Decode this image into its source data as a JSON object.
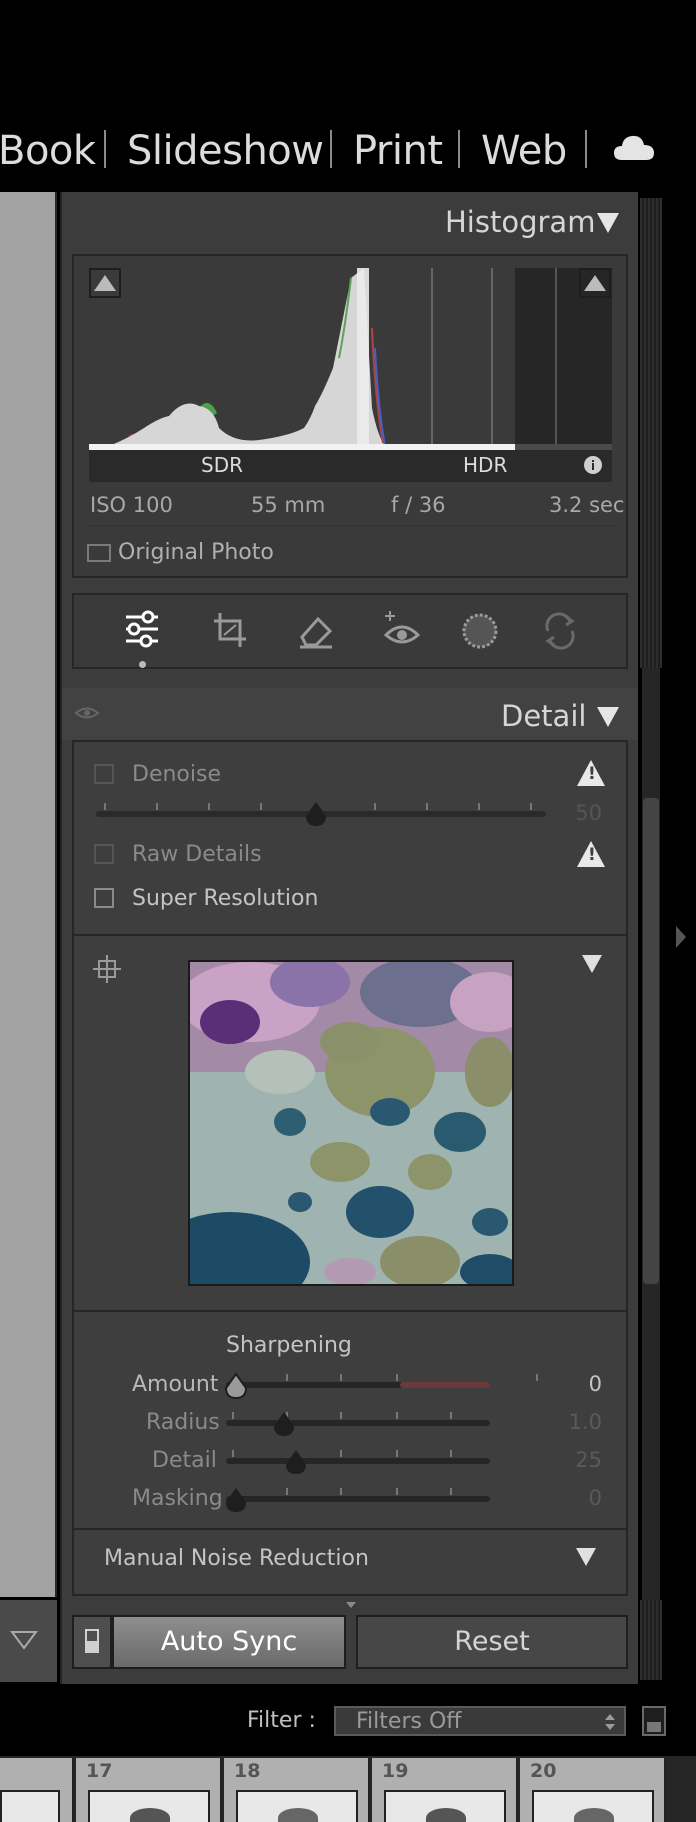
{
  "modules": [
    "Book",
    "Slideshow",
    "Print",
    "Web"
  ],
  "histogram": {
    "title": "Histogram",
    "sdr_label": "SDR",
    "hdr_label": "HDR",
    "iso": "ISO 100",
    "focal_length": "55 mm",
    "aperture": "f / 36",
    "shutter": "3.2 sec",
    "original_photo_label": "Original Photo"
  },
  "detail": {
    "title": "Detail",
    "denoise_label": "Denoise",
    "denoise_value": "50",
    "raw_details_label": "Raw Details",
    "super_resolution_label": "Super Resolution",
    "sharpening_title": "Sharpening",
    "sliders": [
      {
        "label": "Amount",
        "value": "0"
      },
      {
        "label": "Radius",
        "value": "1.0"
      },
      {
        "label": "Detail",
        "value": "25"
      },
      {
        "label": "Masking",
        "value": "0"
      }
    ],
    "noise_reduction_label": "Manual Noise Reduction"
  },
  "buttons": {
    "auto_sync": "Auto Sync",
    "reset": "Reset"
  },
  "filter": {
    "label": "Filter :",
    "value": "Filters Off"
  },
  "filmstrip": {
    "numbers": [
      "17",
      "18",
      "19",
      "20"
    ]
  },
  "colors": {
    "panel_bg": "#3c3c3c",
    "accent_red": "#b84a4a"
  }
}
